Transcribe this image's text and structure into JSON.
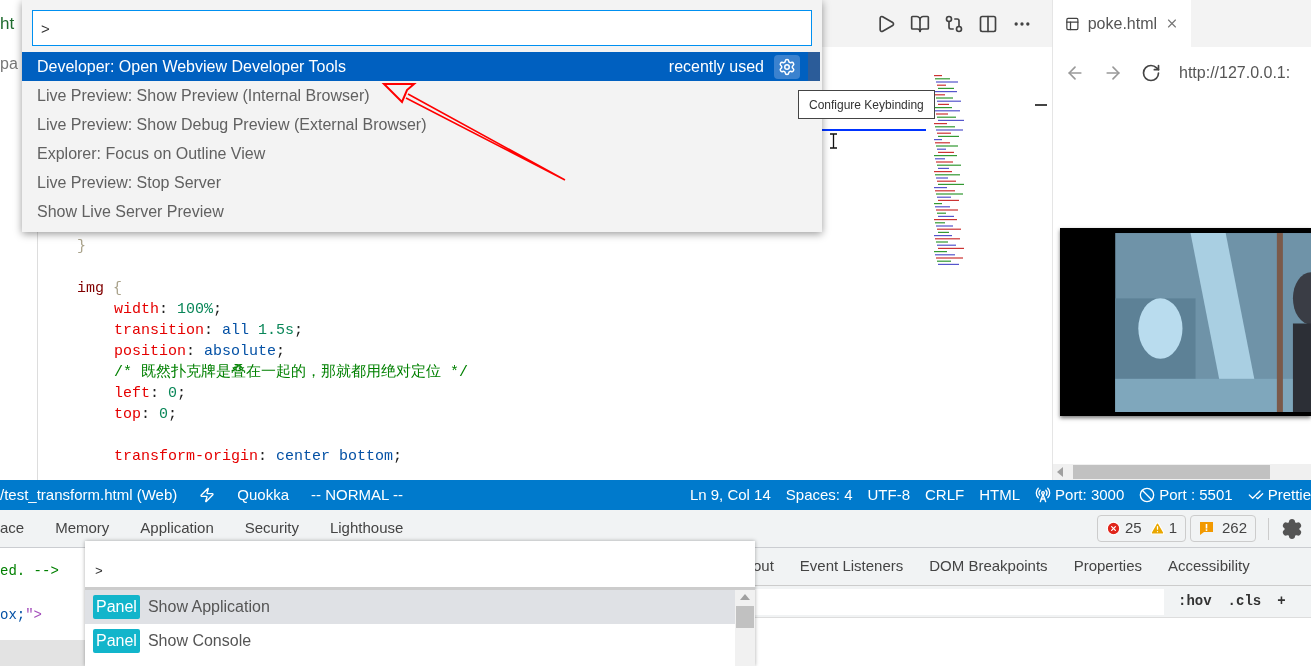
{
  "editor": {
    "tab_label": "ht",
    "breadcrumb": "pa",
    "code_lines": [
      {
        "kind": "rule-end",
        "tokens": [
          {
            "kind": "brace",
            "text": "}"
          }
        ]
      },
      {
        "kind": "blank"
      },
      {
        "kind": "rule-start",
        "tokens": [
          {
            "kind": "selector",
            "text": "img"
          },
          {
            "kind": "brace",
            "text": " {"
          }
        ]
      },
      {
        "kind": "declaration",
        "tokens": [
          {
            "kind": "property",
            "text": "width"
          },
          {
            "kind": "punct",
            "text": ": "
          },
          {
            "kind": "number",
            "text": "100%"
          },
          {
            "kind": "punct",
            "text": ";"
          }
        ]
      },
      {
        "kind": "declaration",
        "tokens": [
          {
            "kind": "property",
            "text": "transition"
          },
          {
            "kind": "punct",
            "text": ": "
          },
          {
            "kind": "value",
            "text": "all"
          },
          {
            "kind": "number",
            "text": " 1.5s"
          },
          {
            "kind": "punct",
            "text": ";"
          }
        ]
      },
      {
        "kind": "declaration",
        "tokens": [
          {
            "kind": "property",
            "text": "position"
          },
          {
            "kind": "punct",
            "text": ": "
          },
          {
            "kind": "value",
            "text": "absolute"
          },
          {
            "kind": "punct",
            "text": ";"
          }
        ]
      },
      {
        "kind": "declaration",
        "tokens": [
          {
            "kind": "comment",
            "text": "/* 既然扑克牌是叠在一起的，那就都用绝对定位 */"
          }
        ]
      },
      {
        "kind": "declaration",
        "tokens": [
          {
            "kind": "property",
            "text": "left"
          },
          {
            "kind": "punct",
            "text": ": "
          },
          {
            "kind": "number",
            "text": "0"
          },
          {
            "kind": "punct",
            "text": ";"
          }
        ]
      },
      {
        "kind": "declaration",
        "tokens": [
          {
            "kind": "property",
            "text": "top"
          },
          {
            "kind": "punct",
            "text": ": "
          },
          {
            "kind": "number",
            "text": "0"
          },
          {
            "kind": "punct",
            "text": ";"
          }
        ]
      },
      {
        "kind": "blank"
      },
      {
        "kind": "declaration",
        "tokens": [
          {
            "kind": "property",
            "text": "transform-origin"
          },
          {
            "kind": "punct",
            "text": ": "
          },
          {
            "kind": "value",
            "text": "center bottom"
          },
          {
            "kind": "punct",
            "text": ";"
          }
        ]
      }
    ]
  },
  "command_palette": {
    "input": ">",
    "items": [
      {
        "label": "Developer: Open Webview Developer Tools",
        "detail": "recently used",
        "selected": true
      },
      {
        "label": "Live Preview: Show Preview (Internal Browser)",
        "selected": false
      },
      {
        "label": "Live Preview: Show Debug Preview (External Browser)",
        "selected": false
      },
      {
        "label": "Explorer: Focus on Outline View",
        "selected": false
      },
      {
        "label": "Live Preview: Stop Server",
        "selected": false
      },
      {
        "label": "Show Live Server Preview",
        "selected": false
      }
    ],
    "tooltip": "Configure Keybinding"
  },
  "preview": {
    "tab_title": "poke.html",
    "url": "http://127.0.0.1:"
  },
  "status_bar": {
    "left": [
      {
        "kind": "text",
        "text": "/test_transform.html (Web)"
      },
      {
        "kind": "bolt"
      },
      {
        "kind": "text",
        "text": "Quokka"
      },
      {
        "kind": "text",
        "text": "-- NORMAL --"
      }
    ],
    "right": [
      {
        "kind": "text",
        "text": "Ln 9, Col 14"
      },
      {
        "kind": "text",
        "text": "Spaces: 4"
      },
      {
        "kind": "text",
        "text": "UTF-8"
      },
      {
        "kind": "text",
        "text": "CRLF"
      },
      {
        "kind": "text",
        "text": "HTML"
      },
      {
        "kind": "antenna",
        "text": "Port: 3000"
      },
      {
        "kind": "blocked",
        "text": "Port : 5501"
      },
      {
        "kind": "checks",
        "text": "Prettie"
      }
    ]
  },
  "devtools": {
    "tabs": [
      "ace",
      "Memory",
      "Application",
      "Security",
      "Lighthouse"
    ],
    "errors": "25",
    "warnings": "1",
    "issues": "262",
    "elements_lines": [
      [
        {
          "kind": "comment",
          "text": "ed. -->"
        }
      ],
      [
        {
          "kind": "value",
          "text": "ox;"
        },
        {
          "kind": "attr",
          "text": "\">"
        }
      ]
    ],
    "sidebar_tabs": [
      "out",
      "Event Listeners",
      "DOM Breakpoints",
      "Properties",
      "Accessibility"
    ],
    "filter_buttons": [
      ":hov",
      ".cls",
      "+"
    ],
    "command_menu": {
      "input": ">",
      "items": [
        {
          "badge": "Panel",
          "label": "Show Application",
          "selected": true
        },
        {
          "badge": "Panel",
          "label": "Show Console",
          "selected": false
        }
      ]
    }
  }
}
